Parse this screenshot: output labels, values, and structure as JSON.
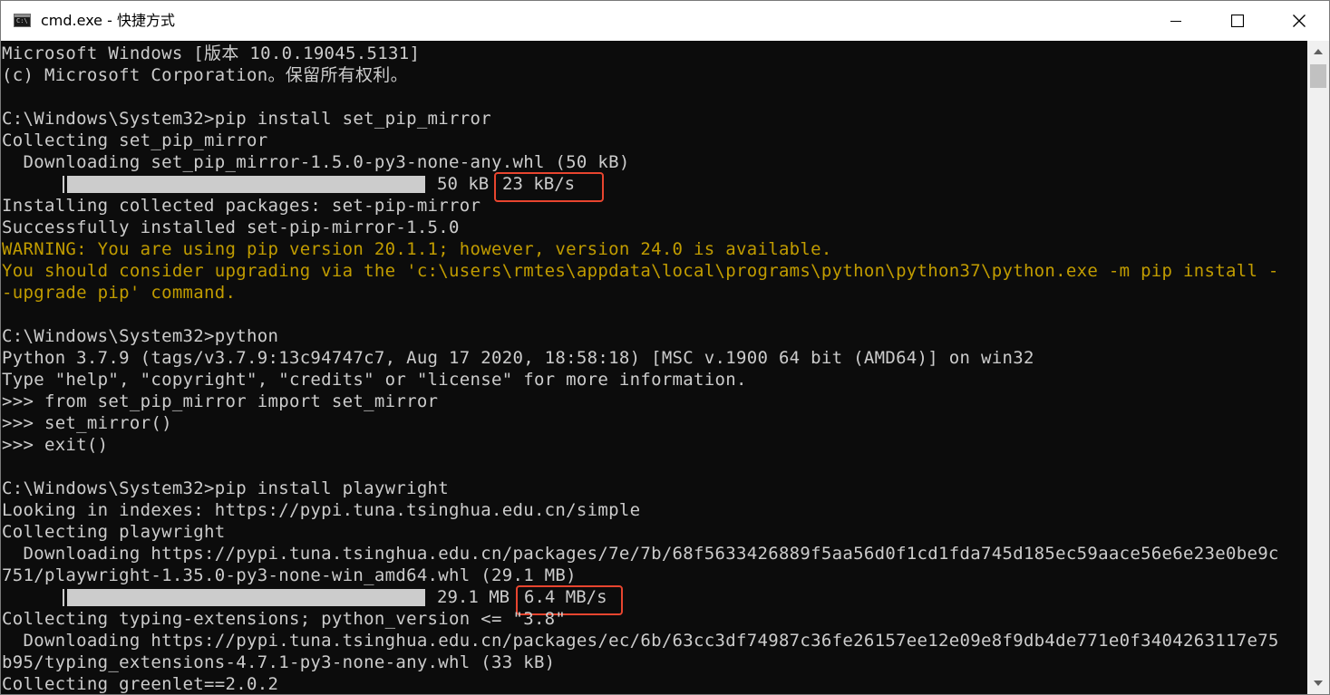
{
  "window": {
    "title": "cmd.exe - 快捷方式",
    "icon": "cmd-icon",
    "controls": [
      "minimize-icon",
      "maximize-icon",
      "close-icon"
    ]
  },
  "colors": {
    "console_bg": "#0c0c0c",
    "text": "#cccccc",
    "warning": "#c19c00",
    "highlight": "#e8452f"
  },
  "console": {
    "line_01": "Microsoft Windows [版本 10.0.19045.5131]",
    "line_02": "(c) Microsoft Corporation。保留所有权利。",
    "line_03": "",
    "line_04": "C:\\Windows\\System32>pip install set_pip_mirror",
    "line_05": "Collecting set_pip_mirror",
    "line_06": "  Downloading set_pip_mirror-1.5.0-py3-none-any.whl (50 kB)",
    "progress_1": {
      "size": "50 kB",
      "speed": "23 kB/s",
      "fraction": 1.0
    },
    "line_08": "Installing collected packages: set-pip-mirror",
    "line_09": "Successfully installed set-pip-mirror-1.5.0",
    "line_10": "WARNING: You are using pip version 20.1.1; however, version 24.0 is available.",
    "line_11": "You should consider upgrading via the 'c:\\users\\rmtes\\appdata\\local\\programs\\python\\python37\\python.exe -m pip install -",
    "line_12": "-upgrade pip' command.",
    "line_13": "",
    "line_14": "C:\\Windows\\System32>python",
    "line_15": "Python 3.7.9 (tags/v3.7.9:13c94747c7, Aug 17 2020, 18:58:18) [MSC v.1900 64 bit (AMD64)] on win32",
    "line_16": "Type \"help\", \"copyright\", \"credits\" or \"license\" for more information.",
    "line_17": ">>> from set_pip_mirror import set_mirror",
    "line_18": ">>> set_mirror()",
    "line_19": ">>> exit()",
    "line_20": "",
    "line_21": "C:\\Windows\\System32>pip install playwright",
    "line_22": "Looking in indexes: https://pypi.tuna.tsinghua.edu.cn/simple",
    "line_23": "Collecting playwright",
    "line_24": "  Downloading https://pypi.tuna.tsinghua.edu.cn/packages/7e/7b/68f5633426889f5aa56d0f1cd1fda745d185ec59aace56e6e23e0be9c",
    "line_25": "751/playwright-1.35.0-py3-none-win_amd64.whl (29.1 MB)",
    "progress_2": {
      "size": "29.1 MB",
      "speed": "6.4 MB/s",
      "fraction": 1.0
    },
    "line_27": "Collecting typing-extensions; python_version <= \"3.8\"",
    "line_28": "  Downloading https://pypi.tuna.tsinghua.edu.cn/packages/ec/6b/63cc3df74987c36fe26157ee12e09e8f9db4de771e0f3404263117e75",
    "line_29": "b95/typing_extensions-4.7.1-py3-none-any.whl (33 kB)",
    "line_30": "Collecting greenlet==2.0.2"
  }
}
